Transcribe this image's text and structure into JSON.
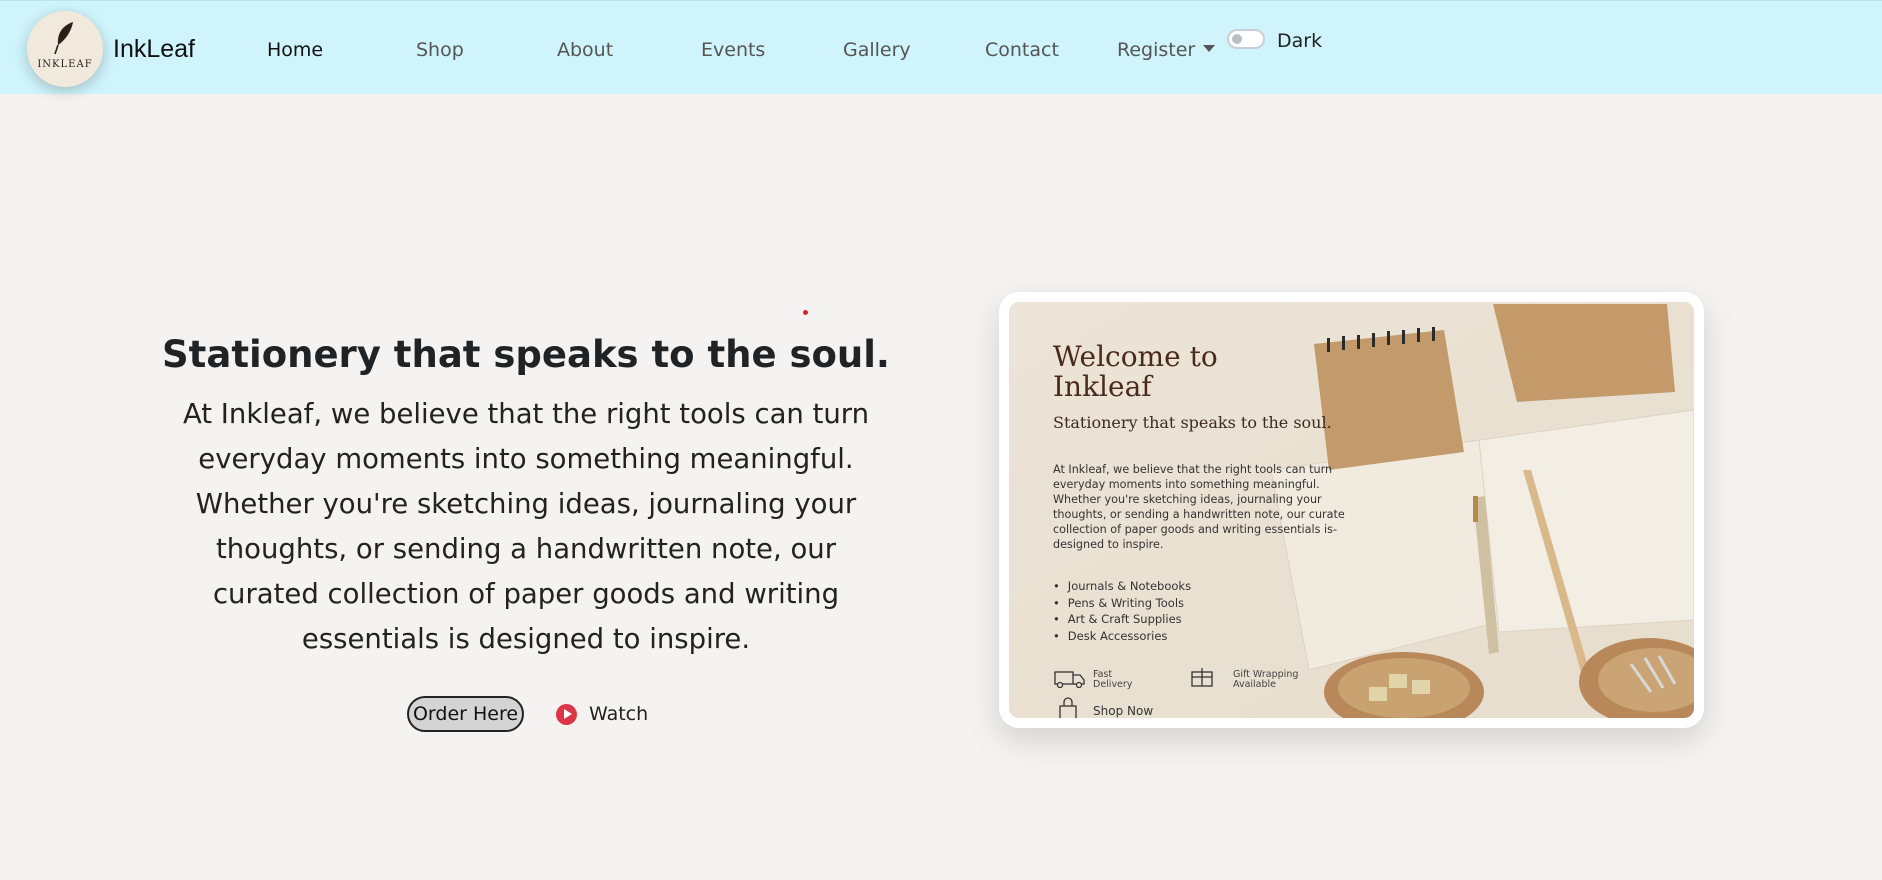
{
  "brand": {
    "name": "InkLeaf",
    "logo_text": "INKLEAF"
  },
  "nav": {
    "items": [
      {
        "label": "Home",
        "active": true
      },
      {
        "label": "Shop"
      },
      {
        "label": "About"
      },
      {
        "label": "Events"
      },
      {
        "label": "Gallery"
      },
      {
        "label": "Contact"
      },
      {
        "label": "Register"
      }
    ],
    "dark_toggle_label": "Dark"
  },
  "hero": {
    "title": "Stationery that speaks to the soul.",
    "text": "At Inkleaf, we believe that the right tools can turn everyday moments into something meaningful. Whether you're sketching ideas, journaling your thoughts, or sending a handwritten note, our curated collection of paper goods and writing essentials is designed to inspire.",
    "order_button": "Order Here",
    "watch_label": "Watch"
  },
  "poster": {
    "title": "Welcome to Inkleaf",
    "subtitle": "Stationery that speaks to the soul.",
    "body": "At Inkleaf, we believe that the right tools can turn everyday moments into something meaningful. Whether you're sketching ideas, journaling your thoughts, or sending a handwritten note, our curate collection of paper goods and writing essentials is-designed to inspire.",
    "list": [
      "Journals & Notebooks",
      "Pens & Writing Tools",
      "Art & Craft Supplies",
      "Desk Accessories"
    ],
    "feature_delivery": "Fast Delivery",
    "feature_gift": "Gift Wrapping Available",
    "shop_now": "Shop Now"
  },
  "colors": {
    "navbar_bg": "#cff4fc",
    "page_bg": "#f5f3f1",
    "accent_red": "#dc3545"
  },
  "icons": [
    "feather-logo-icon",
    "chevron-down-icon",
    "play-icon",
    "truck-icon",
    "gift-icon",
    "bag-icon"
  ]
}
